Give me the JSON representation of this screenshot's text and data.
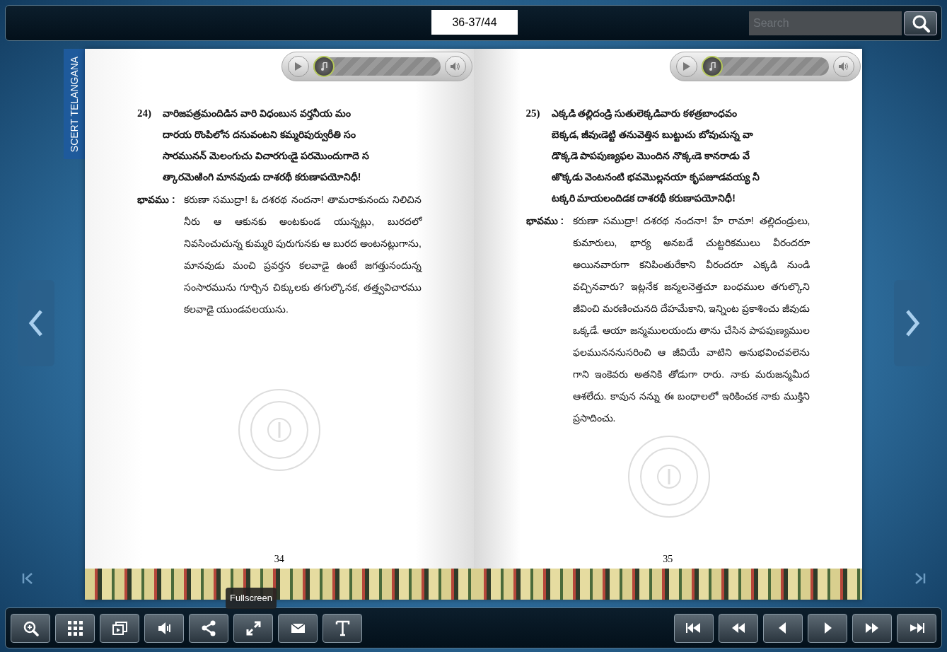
{
  "top_bar": {
    "page_counter": "36-37/44",
    "search": {
      "placeholder": "Search"
    }
  },
  "side_tab": "SCERT TELANGANA",
  "pages": [
    {
      "audio": {
        "level": 0
      },
      "poem_number": "24)",
      "verse": [
        "వారిజపత్రమందిడిన వారి విధంబున వర్తనీయ మం",
        "దారయ రొంపిలోన దనువంటని కమ్మరిపుర్వురీతి సం",
        "సారమునన్ మెలంగుచు విచారగుఁడై పరమొందుగాదె స",
        "త్కారమెఱింగి మానవుఁడు దాశరథీ కరుణాపయోనిధీ!"
      ],
      "meaning_label": "భావము :",
      "meaning": "కరుణా సముద్రా! ఓ దశరథ నందనా! తామరాకునందు నిలిచిన నీరు ఆ ఆకునకు అంటకుండ యున్నట్లు, బురదలో నివసించుచున్న కుమ్మరి పురుగునకు ఆ బురద అంటనట్లుగాను, మానవుడు మంచి ప్రవర్తన కలవాడై ఉంటే జగత్తునందున్న సంసారమును గూర్చిన చిక్కులకు తగుల్కొనక, తత్త్వవిచారము కలవాడై యుండవలయును.",
      "page_number": "34"
    },
    {
      "audio": {
        "level": 0
      },
      "poem_number": "25)",
      "verse": [
        "ఎక్కడి తల్లిదండ్రి సుతులెక్కడివారు కళత్రబాంధవం",
        "బెక్కడ, జీవుఁడెట్టి తనువెత్తిన బుట్టుచు బోవుచున్న వా",
        "డొక్కడె పాపపుణ్యఫల మొందిన నొక్కఁడె కానరాడు వే",
        "ఱొక్కడు వెంటనంటి భవమొల్లనయా కృపజూడవయ్య నీ",
        "టక్కరి మాయలందిడక దాశరథీ కరుణాపయోనిధీ!"
      ],
      "meaning_label": "భావము :",
      "meaning": "కరుణా సముద్రా! దశరథ నందనా! హే రామా! తల్లిదండ్రులు, కుమారులు, భార్య అనబడే చుట్టరికములు వీరందరూ అయినవారుగా కనిపింతురేకాని వీరందరూ ఎక్కడి నుండి వచ్చినవారు? ఇట్లనేక జన్మలనెత్తచూ బంధముల తగుల్కొని జీవించి మరణించునది దేహమేకాని, ఇన్నింట ప్రకాశించు జీవుడు ఒక్కడే. ఆయా జన్మములయందు తాను చేసిన పాపపుణ్యముల ఫలమునననుసరించి ఆ జీవియే వాటిని అనుభవించవలెను గాని ఇంకెవరు అతనికి తోడుగా రారు. నాకు మరుజన్మమీద ఆశలేదు. కావున నన్ను ఈ బంధాలలో ఇరికించక నాకు ముక్తిని ప్రసాదించు.",
      "page_number": "35"
    }
  ],
  "toolbar_left": [
    {
      "kind": "zoom"
    },
    {
      "kind": "thumbnails"
    },
    {
      "kind": "pages"
    },
    {
      "kind": "sound"
    },
    {
      "kind": "share"
    },
    {
      "kind": "fullscreen",
      "tooltip": "Fullscreen"
    },
    {
      "kind": "email"
    },
    {
      "kind": "text"
    }
  ],
  "toolbar_right": [
    {
      "kind": "first"
    },
    {
      "kind": "rewind"
    },
    {
      "kind": "previous"
    },
    {
      "kind": "next"
    },
    {
      "kind": "forward"
    },
    {
      "kind": "last"
    }
  ]
}
